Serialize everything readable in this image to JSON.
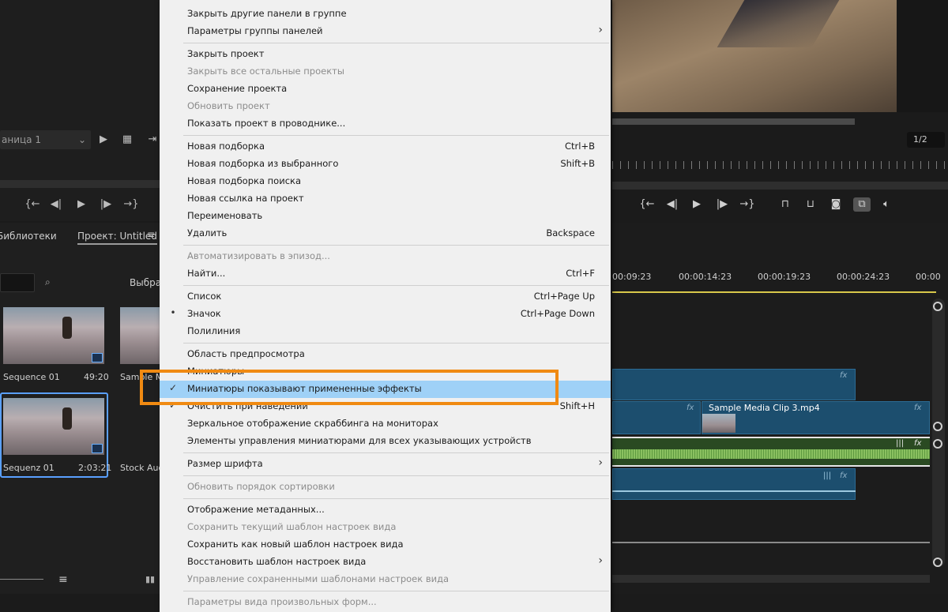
{
  "source_monitor": {
    "page_dropdown": "аница 1"
  },
  "project_panel": {
    "tab_libraries": "Библиотеки",
    "tab_project": "Проект: Untitled",
    "selected_label": "Выбран",
    "items": [
      {
        "name": "Sequence 01",
        "duration": "49:20"
      },
      {
        "name": "Sample Me",
        "duration": ""
      },
      {
        "name": "Sequenz 01",
        "duration": "2:03:21"
      },
      {
        "name": "Stock Audio",
        "duration": ""
      }
    ]
  },
  "program_monitor": {
    "fraction": "1/2"
  },
  "timeline": {
    "timecodes": [
      "00:09:23",
      "00:00:14:23",
      "00:00:19:23",
      "00:00:24:23",
      "00:00"
    ],
    "clip_name": "Sample Media Clip 3.mp4",
    "fx_label": "fx"
  },
  "menu": {
    "items": [
      {
        "label": "Закрыть другие панели в группе"
      },
      {
        "label": "Параметры группы панелей",
        "submenu": true
      },
      {
        "label": "Закрыть проект"
      },
      {
        "label": "Закрыть все остальные проекты",
        "disabled": true
      },
      {
        "label": "Сохранение проекта"
      },
      {
        "label": "Обновить проект",
        "disabled": true
      },
      {
        "label": "Показать проект в проводнике..."
      },
      {
        "label": "Новая подборка",
        "shortcut": "Ctrl+B"
      },
      {
        "label": "Новая подборка из выбранного",
        "shortcut": "Shift+B"
      },
      {
        "label": "Новая подборка поиска"
      },
      {
        "label": "Новая ссылка на проект"
      },
      {
        "label": "Переименовать"
      },
      {
        "label": "Удалить",
        "shortcut": "Backspace"
      },
      {
        "label": "Автоматизировать в эпизод...",
        "disabled": true
      },
      {
        "label": "Найти...",
        "shortcut": "Ctrl+F"
      },
      {
        "label": "Список",
        "shortcut": "Ctrl+Page Up"
      },
      {
        "label": "Значок",
        "shortcut": "Ctrl+Page Down",
        "mark": "•"
      },
      {
        "label": "Полилиния"
      },
      {
        "label": "Область предпросмотра"
      },
      {
        "label": "Миниатюры"
      },
      {
        "label": "Миниатюры показывают примененные эффекты",
        "mark": "✓",
        "highlighted": true
      },
      {
        "label": "Очистить при наведении",
        "shortcut": "Shift+H",
        "mark": "✓"
      },
      {
        "label": "Зеркальное отображение скраббинга на мониторах"
      },
      {
        "label": "Элементы управления миниатюрами для всех указывающих устройств"
      },
      {
        "label": "Размер шрифта",
        "submenu": true
      },
      {
        "label": "Обновить порядок сортировки",
        "disabled": true
      },
      {
        "label": "Отображение метаданных..."
      },
      {
        "label": "Сохранить текущий шаблон настроек вида",
        "disabled": true
      },
      {
        "label": "Сохранить как новый шаблон настроек вида"
      },
      {
        "label": "Восстановить шаблон настроек вида",
        "submenu": true
      },
      {
        "label": "Управление сохраненными шаблонами настроек вида",
        "disabled": true
      },
      {
        "label": "Параметры вида произвольных форм...",
        "disabled": true
      }
    ]
  }
}
